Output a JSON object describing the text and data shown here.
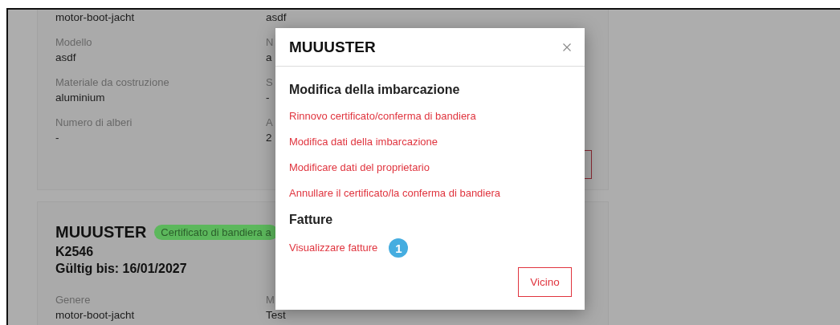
{
  "vessel_cards": [
    {
      "rows": [
        {
          "left": {
            "value": "motor-boot-jacht"
          },
          "right": {
            "value": "asdf"
          }
        },
        {
          "left": {
            "label": "Modello",
            "value": "asdf"
          },
          "right": {
            "label": "N",
            "value": "a"
          }
        },
        {
          "left": {
            "label": "Materiale da costruzione",
            "value": "aluminium"
          },
          "right": {
            "label": "S",
            "value": "-"
          }
        },
        {
          "left": {
            "label": "Numero di alberi",
            "value": "-"
          },
          "right": {
            "label": "A",
            "value": "2"
          }
        }
      ],
      "outline_button": true
    },
    {
      "title": "MUUUSTER",
      "badge": "Certificato di bandiera a",
      "number": "K2546",
      "valid_until": "Gültig bis: 16/01/2027",
      "rows": [
        {
          "left": {
            "label": "Genere",
            "value": "motor-boot-jacht"
          },
          "right": {
            "label": "M",
            "value": "Test"
          }
        }
      ]
    }
  ],
  "modal": {
    "title": "MUUUSTER",
    "sections": [
      {
        "heading": "Modifica della imbarcazione",
        "links": [
          {
            "text": "Rinnovo certificato/conferma di bandiera"
          },
          {
            "text": "Modifica dati della imbarcazione"
          },
          {
            "text": "Modificare dati del proprietario"
          },
          {
            "text": "Annullare il certificato/la conferma di bandiera"
          }
        ]
      },
      {
        "heading": "Fatture",
        "links": [
          {
            "text": "Visualizzare fatture",
            "badge": "1"
          }
        ]
      }
    ],
    "close_button": "Vicino"
  }
}
